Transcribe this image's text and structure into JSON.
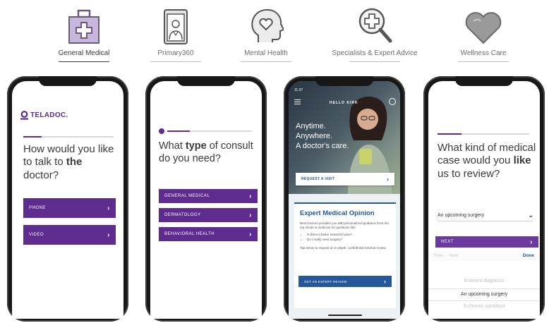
{
  "categories": [
    {
      "label": "General Medical",
      "icon": "medical-kit-icon"
    },
    {
      "label": "Primary360",
      "icon": "doctor-card-icon"
    },
    {
      "label": "Mental Health",
      "icon": "head-heart-icon"
    },
    {
      "label": "Specialists & Expert Advice",
      "icon": "magnifier-plus-icon"
    },
    {
      "label": "Wellness Care",
      "icon": "heart-icon"
    }
  ],
  "colors": {
    "brand": "#5e2b8f",
    "blue": "#27579b"
  },
  "phone1": {
    "logo": "TELADOC.",
    "q_a": "How would you like to talk to ",
    "q_b": "the",
    "q_c": " doctor?",
    "options": [
      "PHONE",
      "VIDEO"
    ]
  },
  "phone2": {
    "q_a": "What ",
    "q_b": "type",
    "q_c": " of consult do you need?",
    "options": [
      "GENERAL MEDICAL",
      "DERMATOLOGY",
      "BEHAVIORAL HEALTH"
    ]
  },
  "phone3": {
    "time": "11:37",
    "header": "HELLO KIRK",
    "hero": [
      "Anytime.",
      "Anywhere.",
      "A doctor's care."
    ],
    "request": "REQUEST A VISIT",
    "title": "Expert Medical Opinion",
    "body": "Best Doctors provides you with personalized guidance from the top minds in medicine for questions like:",
    "bullets": [
      "Is there a better treatment plan?",
      "Do I really need surgery?"
    ],
    "footer": "Tap below to request an in-depth, confidential medical review.",
    "cta": "GET AN EXPERT REVIEW"
  },
  "phone4": {
    "q_a": "What kind of medical case would you ",
    "q_b": "like",
    "q_c": " us to review?",
    "select": "An upcoming surgery",
    "next": "NEXT",
    "prev": "Prev",
    "nxt": "Next",
    "done": "Done",
    "picker": [
      "A recent diagnosis",
      "An upcoming surgery",
      "A chronic condition"
    ]
  }
}
